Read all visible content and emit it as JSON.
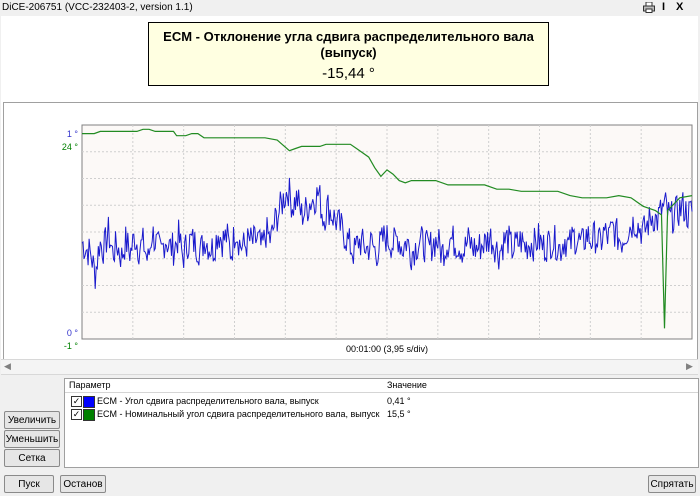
{
  "window": {
    "title": "DiCE-206751   (VCC-232403-2, version 1.1)",
    "tb_icons": [
      "printer-icon",
      "info-icon",
      "close-icon"
    ],
    "info_label": "I",
    "close_label": "X"
  },
  "readout": {
    "title": "ECM - Отклонение угла сдвига распределительного вала (выпуск)",
    "value": "-15,44 °"
  },
  "chart_data": {
    "type": "line",
    "time_label": "00:01:00 (3,95 s/div)",
    "left_axis": [
      {
        "tick_top": "1 °",
        "tick_bottom": "0 °",
        "color": "#3333cc"
      },
      {
        "tick_top": "24 °",
        "tick_bottom": "-1 °",
        "color": "#008000"
      }
    ],
    "grid": true,
    "series": [
      {
        "name": "ECM - Угол сдвига распределительного вала, выпуск",
        "color": "#1a1acc",
        "unit": "°",
        "y_range": [
          0,
          1
        ],
        "y": [
          0.45,
          0.42,
          0.4,
          0.3,
          0.45,
          0.42,
          0.5,
          0.4,
          0.44,
          0.38,
          0.46,
          0.4,
          0.48,
          0.42,
          0.45,
          0.36,
          0.5,
          0.44,
          0.4,
          0.47,
          0.43,
          0.42,
          0.48,
          0.38,
          0.45,
          0.46,
          0.44,
          0.41,
          0.47,
          0.43,
          0.42,
          0.5,
          0.46,
          0.48,
          0.4,
          0.52,
          0.44,
          0.43,
          0.46,
          0.45,
          0.47,
          0.42,
          0.5,
          0.46,
          0.55,
          0.6,
          0.66,
          0.7,
          0.62,
          0.66,
          0.58,
          0.6,
          0.64,
          0.66,
          0.68,
          0.56,
          0.62,
          0.58,
          0.55,
          0.52,
          0.48,
          0.44,
          0.4,
          0.46,
          0.44,
          0.42,
          0.45,
          0.4,
          0.44,
          0.48,
          0.46,
          0.44,
          0.48,
          0.42,
          0.46,
          0.4,
          0.43,
          0.46,
          0.44,
          0.42,
          0.45,
          0.46,
          0.4,
          0.44,
          0.47,
          0.45,
          0.44,
          0.41,
          0.46,
          0.43,
          0.42,
          0.44,
          0.45,
          0.48,
          0.44,
          0.4,
          0.45,
          0.47,
          0.42,
          0.44,
          0.46,
          0.43,
          0.45,
          0.44,
          0.47,
          0.43,
          0.44,
          0.46,
          0.45,
          0.42,
          0.47,
          0.43,
          0.48,
          0.46,
          0.44,
          0.49,
          0.46,
          0.48,
          0.44,
          0.5,
          0.47,
          0.52,
          0.48,
          0.46,
          0.5,
          0.53,
          0.55,
          0.52,
          0.5,
          0.54,
          0.58,
          0.55,
          0.6,
          0.62,
          0.56,
          0.58,
          0.6,
          0.62,
          0.58,
          0.6
        ],
        "current_value": "0,41 °"
      },
      {
        "name": "ECM - Номинальный угол сдвига распределительного вала, выпуск",
        "color": "#228b22",
        "unit": "°",
        "points": [
          [
            0,
            0.96
          ],
          [
            0.02,
            0.96
          ],
          [
            0.03,
            0.97
          ],
          [
            0.05,
            0.97
          ],
          [
            0.09,
            0.97
          ],
          [
            0.1,
            0.98
          ],
          [
            0.11,
            0.98
          ],
          [
            0.12,
            0.97
          ],
          [
            0.15,
            0.97
          ],
          [
            0.155,
            0.95
          ],
          [
            0.17,
            0.95
          ],
          [
            0.18,
            0.96
          ],
          [
            0.19,
            0.96
          ],
          [
            0.2,
            0.94
          ],
          [
            0.3,
            0.94
          ],
          [
            0.32,
            0.93
          ],
          [
            0.34,
            0.88
          ],
          [
            0.35,
            0.89
          ],
          [
            0.36,
            0.9
          ],
          [
            0.39,
            0.9
          ],
          [
            0.4,
            0.91
          ],
          [
            0.44,
            0.91
          ],
          [
            0.45,
            0.89
          ],
          [
            0.47,
            0.85
          ],
          [
            0.48,
            0.8
          ],
          [
            0.49,
            0.76
          ],
          [
            0.5,
            0.79
          ],
          [
            0.51,
            0.77
          ],
          [
            0.52,
            0.74
          ],
          [
            0.53,
            0.73
          ],
          [
            0.54,
            0.74
          ],
          [
            0.58,
            0.74
          ],
          [
            0.6,
            0.72
          ],
          [
            0.66,
            0.72
          ],
          [
            0.68,
            0.7
          ],
          [
            0.7,
            0.7
          ],
          [
            0.72,
            0.69
          ],
          [
            0.78,
            0.69
          ],
          [
            0.8,
            0.67
          ],
          [
            0.82,
            0.66
          ],
          [
            0.86,
            0.66
          ],
          [
            0.88,
            0.67
          ],
          [
            0.9,
            0.66
          ],
          [
            0.92,
            0.62
          ],
          [
            0.94,
            0.6
          ],
          [
            0.95,
            0.58
          ],
          [
            0.955,
            0.05
          ],
          [
            0.96,
            0.6
          ],
          [
            0.98,
            0.66
          ],
          [
            1.0,
            0.67
          ]
        ],
        "current_value": "15,5 °"
      }
    ]
  },
  "params": {
    "header_name": "Параметр",
    "header_value": "Значение",
    "rows": [
      {
        "name": "ECM - Угол сдвига распределительного вала, выпуск",
        "value": "0,41 °",
        "color": "#0000ff",
        "checked": "✓"
      },
      {
        "name": "ECM - Номинальный угол сдвига распределительного вала, выпуск",
        "value": "15,5 °",
        "color": "#008000",
        "checked": "✓"
      }
    ]
  },
  "buttons": {
    "zoom_in": "Увеличить",
    "zoom_out": "Уменьшить",
    "grid": "Сетка",
    "start": "Пуск",
    "stop": "Останов",
    "hide": "Спрятать"
  },
  "scroll": {
    "left_arrow": "◀",
    "right_arrow": "▶"
  }
}
